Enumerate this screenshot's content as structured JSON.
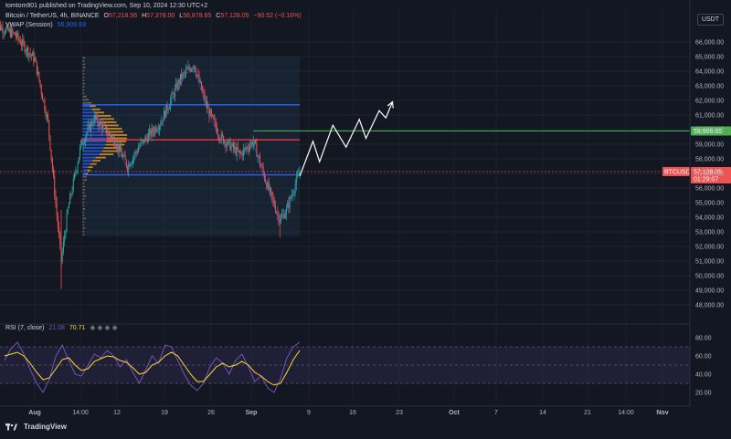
{
  "publish_line": "tomtom901 published on TradingView.com, Sep 10, 2024 12:30 UTC+2",
  "symbol_line": {
    "name": "Bitcoin / TetherUS, 4h, BINANCE",
    "o_label": "O",
    "o": "57,218.56",
    "h_label": "H",
    "h": "57,378.00",
    "l_label": "L",
    "l": "56,878.65",
    "c_label": "C",
    "c": "57,128.05",
    "change": "−90.52 (−0.16%)"
  },
  "vwap_line": {
    "name": "VWAP (Session)",
    "value": "56,909.93"
  },
  "currency": "USDT",
  "rsi_line": {
    "name": "RSI (7, close)",
    "v1": "21.08",
    "v2": "70.71"
  },
  "brand": "TradingView",
  "colors": {
    "background": "#131722",
    "up": "#26a69a",
    "down": "#ef5350",
    "blue_level": "#2962ff",
    "red_level": "#f23645",
    "green_level": "#4caf50",
    "rsi_line": "#7e57c2",
    "rsi_ma": "#fdd835",
    "profile_box": "#1f3a4a"
  },
  "chart_data": [
    {
      "type": "candlestick",
      "symbol": "BTCUSDT",
      "interval": "4h",
      "ylim": [
        47000,
        67000
      ],
      "y_ticks": [
        "66,000.00",
        "65,000.00",
        "64,000.00",
        "63,000.00",
        "62,000.00",
        "61,000.00",
        "60,000.00",
        "59,000.00",
        "58,000.00",
        "57,000.00",
        "56,000.00",
        "55,000.00",
        "54,000.00",
        "53,000.00",
        "52,000.00",
        "51,000.00",
        "50,000.00",
        "49,000.00",
        "48,000.00"
      ],
      "x_ticks": [
        "Aug",
        "14:00",
        "12",
        "19",
        "26",
        "Sep",
        "9",
        "16",
        "23",
        "Oct",
        "7",
        "14",
        "21",
        "14:00",
        "Nov"
      ],
      "price_path": [
        {
          "x": "Jul 26",
          "y": 67200
        },
        {
          "x": "Jul 29",
          "y": 66500
        },
        {
          "x": "Aug 1",
          "y": 64800
        },
        {
          "x": "Aug 3",
          "y": 60500
        },
        {
          "x": "Aug 5",
          "y": 51000
        },
        {
          "x": "Aug 6",
          "y": 54500
        },
        {
          "x": "Aug 8",
          "y": 59000
        },
        {
          "x": "Aug 10",
          "y": 60800
        },
        {
          "x": "Aug 13",
          "y": 59300
        },
        {
          "x": "Aug 15",
          "y": 57500
        },
        {
          "x": "Aug 17",
          "y": 59000
        },
        {
          "x": "Aug 20",
          "y": 60500
        },
        {
          "x": "Aug 23",
          "y": 63500
        },
        {
          "x": "Aug 25",
          "y": 64500
        },
        {
          "x": "Aug 27",
          "y": 61500
        },
        {
          "x": "Aug 29",
          "y": 59500
        },
        {
          "x": "Sep 1",
          "y": 58300
        },
        {
          "x": "Sep 3",
          "y": 59200
        },
        {
          "x": "Sep 5",
          "y": 56300
        },
        {
          "x": "Sep 7",
          "y": 53800
        },
        {
          "x": "Sep 8",
          "y": 54500
        },
        {
          "x": "Sep 10",
          "y": 57128
        }
      ],
      "levels": [
        {
          "price": 61700,
          "color": "blue"
        },
        {
          "price": 59300,
          "color": "red"
        },
        {
          "price": 56900,
          "color": "blue"
        },
        {
          "price": 59909.65,
          "color": "green",
          "label": "59,909.65"
        }
      ],
      "last_price": {
        "symbol": "BTCUSDT",
        "price": "57,128.05",
        "countdown": "01:29:07"
      },
      "projection": [
        {
          "x": "Sep 10",
          "y": 56800
        },
        {
          "x": "Sep 12",
          "y": 59200
        },
        {
          "x": "Sep 13",
          "y": 57800
        },
        {
          "x": "Sep 15",
          "y": 60300
        },
        {
          "x": "Sep 17",
          "y": 58800
        },
        {
          "x": "Sep 19",
          "y": 60700
        },
        {
          "x": "Sep 20",
          "y": 59400
        },
        {
          "x": "Sep 22",
          "y": 61300
        },
        {
          "x": "Sep 23",
          "y": 60800
        },
        {
          "x": "Sep 24",
          "y": 61900
        }
      ]
    },
    {
      "type": "line",
      "title": "RSI (7, close)",
      "ylim": [
        10,
        90
      ],
      "y_ticks": [
        "80.00",
        "60.00",
        "40.00",
        "20.00"
      ],
      "bands": [
        70,
        50,
        30
      ],
      "series": [
        {
          "name": "RSI",
          "values": [
            55,
            68,
            75,
            62,
            45,
            30,
            20,
            35,
            60,
            72,
            55,
            40,
            38,
            50,
            62,
            58,
            66,
            60,
            48,
            56,
            42,
            30,
            45,
            60,
            52,
            72,
            70,
            55,
            40,
            28,
            22,
            30,
            48,
            58,
            52,
            40,
            55,
            62,
            48,
            32,
            38,
            25,
            20,
            35,
            58,
            70,
            75
          ]
        },
        {
          "name": "RSI MA",
          "values": [
            60,
            62,
            64,
            60,
            52,
            42,
            34,
            36,
            46,
            56,
            58,
            50,
            44,
            46,
            54,
            57,
            60,
            59,
            55,
            53,
            47,
            40,
            42,
            50,
            53,
            60,
            64,
            60,
            50,
            40,
            32,
            32,
            40,
            48,
            52,
            48,
            50,
            54,
            50,
            42,
            38,
            32,
            28,
            30,
            42,
            56,
            66
          ]
        }
      ]
    }
  ]
}
